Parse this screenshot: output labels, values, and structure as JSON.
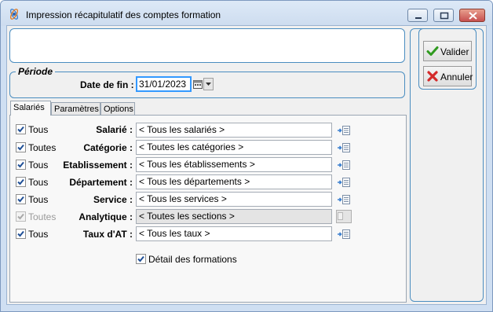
{
  "window": {
    "title": "Impression récapitulatif des comptes formation"
  },
  "comment": {
    "value": ""
  },
  "periode": {
    "legend": "Période",
    "date_label": "Date de fin :",
    "date_value": "31/01/2023"
  },
  "tabs": [
    {
      "label": "Salariés",
      "active": true
    },
    {
      "label": "Paramètres",
      "active": false
    },
    {
      "label": "Options",
      "active": false
    }
  ],
  "filters": [
    {
      "checkbox_label": "Tous",
      "checked": true,
      "enabled": true,
      "field_label": "Salarié :",
      "value": "< Tous les salariés >"
    },
    {
      "checkbox_label": "Toutes",
      "checked": true,
      "enabled": true,
      "field_label": "Catégorie :",
      "value": "< Toutes les catégories >"
    },
    {
      "checkbox_label": "Tous",
      "checked": true,
      "enabled": true,
      "field_label": "Etablissement :",
      "value": "< Tous les établissements >"
    },
    {
      "checkbox_label": "Tous",
      "checked": true,
      "enabled": true,
      "field_label": "Département :",
      "value": "< Tous les départements >"
    },
    {
      "checkbox_label": "Tous",
      "checked": true,
      "enabled": true,
      "field_label": "Service :",
      "value": "< Tous les services >"
    },
    {
      "checkbox_label": "Toutes",
      "checked": true,
      "enabled": false,
      "field_label": "Analytique :",
      "value": "< Toutes les sections >"
    },
    {
      "checkbox_label": "Tous",
      "checked": true,
      "enabled": true,
      "field_label": "Taux d'AT :",
      "value": "< Tous les taux >"
    }
  ],
  "detail": {
    "label": "Détail des formations",
    "checked": true
  },
  "buttons": {
    "valider": "Valider",
    "annuler": "Annuler"
  },
  "colors": {
    "titlebar": "#d6e4f5",
    "panel_border": "#4a8dc0",
    "focus": "#3399ff",
    "check": "#1f4f96"
  }
}
